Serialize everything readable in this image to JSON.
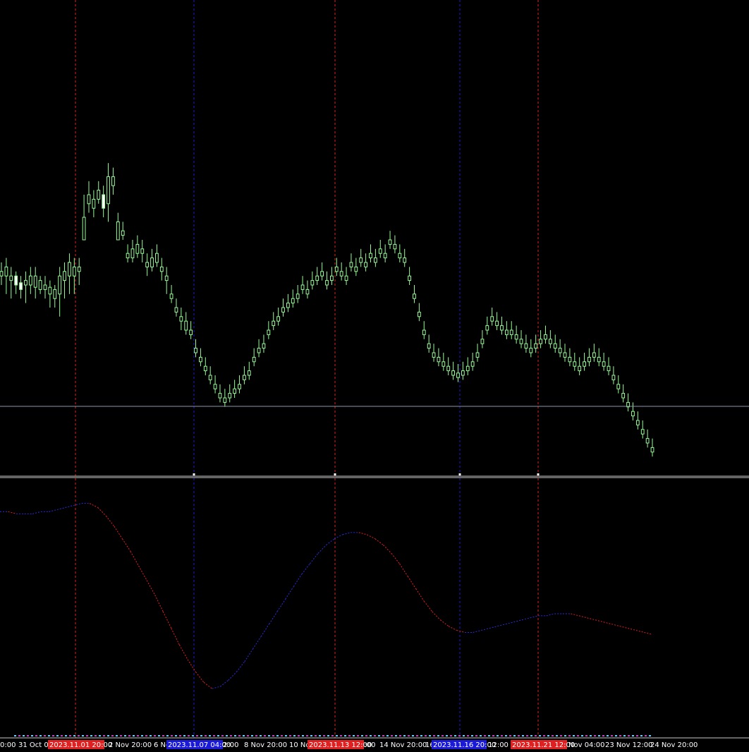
{
  "chart_data": [
    {
      "type": "candlestick",
      "title": "",
      "y_scale": "linear",
      "colors": {
        "bull": "#98fb98",
        "bear": "#98fb98",
        "bear_body": "#000000",
        "bull_body": "#ffffff",
        "background": "#000000"
      },
      "ylim": [
        0,
        1000
      ],
      "candles": [
        [
          430,
          420,
          450,
          400
        ],
        [
          440,
          420,
          460,
          380
        ],
        [
          420,
          410,
          440,
          370
        ],
        [
          400,
          420,
          430,
          380
        ],
        [
          390,
          405,
          420,
          370
        ],
        [
          410,
          400,
          430,
          360
        ],
        [
          420,
          400,
          440,
          380
        ],
        [
          420,
          395,
          440,
          370
        ],
        [
          410,
          390,
          420,
          380
        ],
        [
          400,
          390,
          420,
          370
        ],
        [
          395,
          380,
          410,
          350
        ],
        [
          390,
          370,
          400,
          350
        ],
        [
          420,
          380,
          440,
          330
        ],
        [
          430,
          410,
          450,
          370
        ],
        [
          450,
          420,
          470,
          380
        ],
        [
          440,
          420,
          460,
          380
        ],
        [
          440,
          430,
          460,
          400
        ],
        [
          550,
          500,
          600,
          520
        ],
        [
          600,
          580,
          630,
          560
        ],
        [
          590,
          570,
          610,
          550
        ],
        [
          610,
          590,
          630,
          580
        ],
        [
          570,
          600,
          620,
          550
        ],
        [
          640,
          580,
          670,
          540
        ],
        [
          640,
          620,
          660,
          600
        ],
        [
          540,
          500,
          560,
          500
        ],
        [
          520,
          510,
          540,
          500
        ],
        [
          470,
          460,
          490,
          450
        ],
        [
          480,
          460,
          500,
          450
        ],
        [
          490,
          470,
          510,
          460
        ],
        [
          480,
          470,
          500,
          450
        ],
        [
          450,
          440,
          470,
          420
        ],
        [
          460,
          440,
          480,
          430
        ],
        [
          470,
          450,
          490,
          440
        ],
        [
          440,
          430,
          460,
          410
        ],
        [
          420,
          410,
          440,
          380
        ],
        [
          380,
          370,
          400,
          360
        ],
        [
          350,
          340,
          370,
          330
        ],
        [
          330,
          320,
          350,
          300
        ],
        [
          320,
          300,
          340,
          290
        ],
        [
          300,
          290,
          320,
          280
        ],
        [
          260,
          250,
          280,
          240
        ],
        [
          240,
          230,
          260,
          220
        ],
        [
          220,
          210,
          240,
          200
        ],
        [
          200,
          190,
          220,
          180
        ],
        [
          180,
          170,
          200,
          160
        ],
        [
          160,
          150,
          180,
          140
        ],
        [
          150,
          140,
          170,
          130
        ],
        [
          160,
          150,
          180,
          140
        ],
        [
          170,
          160,
          190,
          150
        ],
        [
          180,
          170,
          200,
          160
        ],
        [
          200,
          190,
          220,
          180
        ],
        [
          210,
          200,
          230,
          190
        ],
        [
          240,
          230,
          260,
          220
        ],
        [
          260,
          250,
          280,
          240
        ],
        [
          270,
          260,
          290,
          250
        ],
        [
          300,
          290,
          320,
          280
        ],
        [
          320,
          310,
          340,
          300
        ],
        [
          330,
          320,
          350,
          310
        ],
        [
          350,
          340,
          370,
          330
        ],
        [
          360,
          350,
          380,
          340
        ],
        [
          370,
          360,
          390,
          350
        ],
        [
          380,
          370,
          400,
          360
        ],
        [
          400,
          390,
          420,
          380
        ],
        [
          390,
          380,
          410,
          370
        ],
        [
          410,
          400,
          430,
          390
        ],
        [
          420,
          410,
          440,
          400
        ],
        [
          430,
          420,
          450,
          410
        ],
        [
          410,
          400,
          430,
          390
        ],
        [
          420,
          410,
          440,
          400
        ],
        [
          440,
          430,
          460,
          420
        ],
        [
          430,
          420,
          450,
          410
        ],
        [
          420,
          410,
          440,
          400
        ],
        [
          450,
          440,
          470,
          430
        ],
        [
          440,
          430,
          460,
          420
        ],
        [
          460,
          450,
          480,
          440
        ],
        [
          450,
          440,
          470,
          430
        ],
        [
          470,
          460,
          490,
          450
        ],
        [
          460,
          450,
          480,
          440
        ],
        [
          480,
          470,
          500,
          460
        ],
        [
          470,
          460,
          490,
          450
        ],
        [
          500,
          490,
          520,
          480
        ],
        [
          490,
          480,
          510,
          470
        ],
        [
          470,
          460,
          490,
          450
        ],
        [
          460,
          450,
          480,
          440
        ],
        [
          420,
          410,
          440,
          400
        ],
        [
          380,
          370,
          400,
          360
        ],
        [
          340,
          330,
          360,
          320
        ],
        [
          300,
          290,
          320,
          280
        ],
        [
          270,
          260,
          290,
          250
        ],
        [
          250,
          240,
          270,
          230
        ],
        [
          240,
          230,
          260,
          220
        ],
        [
          230,
          220,
          250,
          210
        ],
        [
          220,
          210,
          240,
          200
        ],
        [
          210,
          200,
          230,
          190
        ],
        [
          205,
          195,
          225,
          185
        ],
        [
          210,
          200,
          230,
          190
        ],
        [
          220,
          210,
          240,
          200
        ],
        [
          230,
          220,
          250,
          210
        ],
        [
          250,
          240,
          270,
          230
        ],
        [
          280,
          270,
          300,
          260
        ],
        [
          310,
          300,
          330,
          290
        ],
        [
          330,
          320,
          350,
          310
        ],
        [
          320,
          310,
          340,
          300
        ],
        [
          310,
          300,
          330,
          290
        ],
        [
          300,
          290,
          320,
          280
        ],
        [
          300,
          290,
          320,
          280
        ],
        [
          290,
          280,
          310,
          270
        ],
        [
          280,
          270,
          300,
          260
        ],
        [
          270,
          260,
          290,
          250
        ],
        [
          260,
          250,
          280,
          240
        ],
        [
          270,
          260,
          290,
          250
        ],
        [
          280,
          270,
          300,
          260
        ],
        [
          290,
          280,
          310,
          270
        ],
        [
          280,
          270,
          300,
          260
        ],
        [
          270,
          260,
          290,
          250
        ],
        [
          260,
          250,
          280,
          240
        ],
        [
          250,
          240,
          270,
          230
        ],
        [
          240,
          230,
          260,
          220
        ],
        [
          230,
          220,
          250,
          210
        ],
        [
          220,
          210,
          240,
          200
        ],
        [
          230,
          220,
          250,
          210
        ],
        [
          240,
          230,
          260,
          220
        ],
        [
          250,
          240,
          270,
          230
        ],
        [
          240,
          230,
          260,
          220
        ],
        [
          230,
          220,
          250,
          210
        ],
        [
          220,
          210,
          240,
          200
        ],
        [
          200,
          190,
          220,
          180
        ],
        [
          180,
          170,
          200,
          160
        ],
        [
          160,
          150,
          180,
          140
        ],
        [
          140,
          130,
          160,
          120
        ],
        [
          120,
          110,
          140,
          100
        ],
        [
          100,
          90,
          120,
          80
        ],
        [
          80,
          70,
          100,
          60
        ],
        [
          60,
          50,
          80,
          40
        ],
        [
          40,
          30,
          60,
          20
        ]
      ],
      "oscillator": {
        "ylim": [
          0,
          100
        ],
        "colors": {
          "rising": "#2b2bd8",
          "falling": "#e02020"
        },
        "values": [
          88,
          88,
          87,
          87,
          87,
          88,
          88,
          89,
          90,
          91,
          92,
          92,
          90,
          86,
          81,
          75,
          69,
          62,
          55,
          48,
          40,
          32,
          24,
          17,
          11,
          6,
          3,
          4,
          7,
          11,
          16,
          22,
          28,
          34,
          40,
          46,
          52,
          58,
          63,
          68,
          72,
          75,
          77,
          78,
          78,
          77,
          75,
          72,
          68,
          63,
          57,
          51,
          45,
          40,
          36,
          33,
          31,
          30,
          30,
          31,
          32,
          33,
          34,
          35,
          36,
          37,
          38,
          38,
          39,
          39,
          39,
          38,
          37,
          36,
          35,
          34,
          33,
          32,
          31,
          30,
          29
        ]
      },
      "markers": [
        {
          "label": "2023.11.01 20:00",
          "color": "#e02020"
        },
        {
          "label": "2023.11.07 04:00",
          "color": "#1a1ad8"
        },
        {
          "label": "2023.11.13 12:00",
          "color": "#e02020"
        },
        {
          "label": "2023.11.16 20:00",
          "color": "#1a1ad8"
        },
        {
          "label": "2023.11.21 12:00",
          "color": "#e02020"
        }
      ],
      "x_ticks": [
        "0:00",
        "31 Oct 04",
        "2 Nov 20:00",
        "6 No",
        "2:00",
        "8 Nov 20:00",
        "10 No",
        "2:00",
        "14 Nov 20:00",
        "16",
        "v 12:00",
        "Nov 04:00",
        "23 Nov 12:00",
        "24 Nov 20:00"
      ]
    }
  ]
}
